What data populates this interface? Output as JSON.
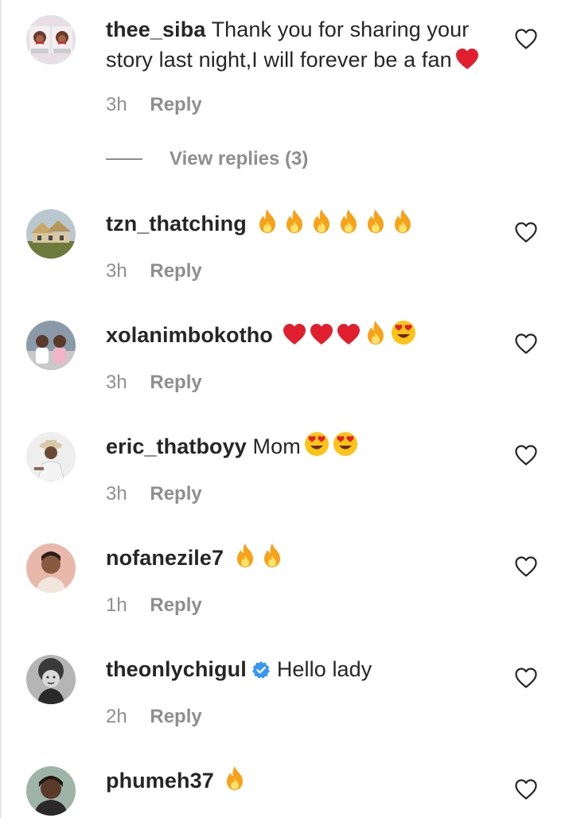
{
  "comments": [
    {
      "username": "thee_siba",
      "text_line1": "Thank you for sharing your",
      "text_line2": "story last night,I will forever be a fan",
      "emojis": [
        "red-heart"
      ],
      "time": "3h",
      "reply_label": "Reply",
      "view_replies": "View replies (3)",
      "verified": false
    },
    {
      "username": "tzn_thatching",
      "text": "",
      "emojis": [
        "fire",
        "fire",
        "fire",
        "fire",
        "fire",
        "fire"
      ],
      "time": "3h",
      "reply_label": "Reply"
    },
    {
      "username": "xolanimbokotho",
      "text": "",
      "emojis": [
        "red-heart",
        "red-heart",
        "red-heart",
        "fire",
        "heart-eyes"
      ],
      "time": "3h",
      "reply_label": "Reply"
    },
    {
      "username": "eric_thatboyy",
      "text": "Mom",
      "emojis": [
        "heart-eyes",
        "heart-eyes"
      ],
      "time": "3h",
      "reply_label": "Reply"
    },
    {
      "username": "nofanezile7",
      "text": "",
      "emojis": [
        "fire",
        "fire"
      ],
      "time": "1h",
      "reply_label": "Reply"
    },
    {
      "username": "theonlychigul",
      "text": "Hello lady",
      "emojis": [],
      "verified": true,
      "time": "2h",
      "reply_label": "Reply"
    },
    {
      "username": "phumeh37",
      "text": "",
      "emojis": [
        "fire"
      ],
      "time": "",
      "reply_label": ""
    }
  ],
  "colors": {
    "text": "#262626",
    "secondary": "#8e8e8e",
    "verified": "#3897f0",
    "heart": "#e0202f",
    "fire": "#f7a21b"
  },
  "icons": {
    "like": "heart-outline-icon",
    "verified": "verified-badge-icon"
  }
}
